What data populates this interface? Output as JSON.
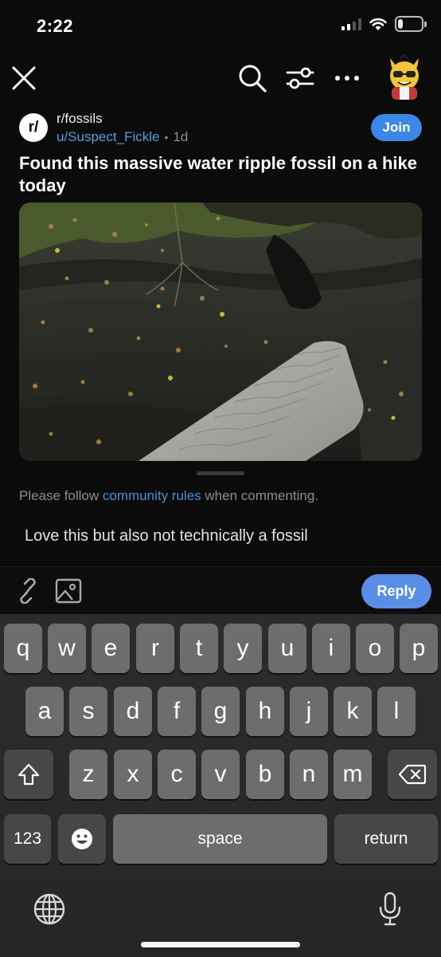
{
  "status_bar": {
    "time": "2:22",
    "battery": "14"
  },
  "header": {
    "close_icon": "close-icon",
    "search_icon": "search-icon",
    "filter_icon": "sliders-icon",
    "more_icon": "more-horizontal-icon"
  },
  "post": {
    "subreddit": "r/fossils",
    "subreddit_icon_text": "r/",
    "author": "u/Suspect_Fickle",
    "separator": "•",
    "age": "1d",
    "join_label": "Join",
    "title": "Found this massive water ripple fossil on a hike today"
  },
  "comment": {
    "rules_prefix": "Please follow ",
    "rules_link": "community rules",
    "rules_suffix": " when commenting.",
    "draft_text": "Love this but also not technically a fossil"
  },
  "reply_bar": {
    "link_icon": "link-icon",
    "image_icon": "image-icon",
    "reply_label": "Reply"
  },
  "keyboard": {
    "row1": [
      "q",
      "w",
      "e",
      "r",
      "t",
      "y",
      "u",
      "i",
      "o",
      "p"
    ],
    "row2": [
      "a",
      "s",
      "d",
      "f",
      "g",
      "h",
      "j",
      "k",
      "l"
    ],
    "row3": [
      "z",
      "x",
      "c",
      "v",
      "b",
      "n",
      "m"
    ],
    "numbers_label": "123",
    "space_label": "space",
    "return_label": "return"
  },
  "colors": {
    "accent_blue": "#3c87e6",
    "reply_blue": "#5a8ee6",
    "link_blue": "#5a9fe0",
    "background": "#0b0b0b"
  }
}
